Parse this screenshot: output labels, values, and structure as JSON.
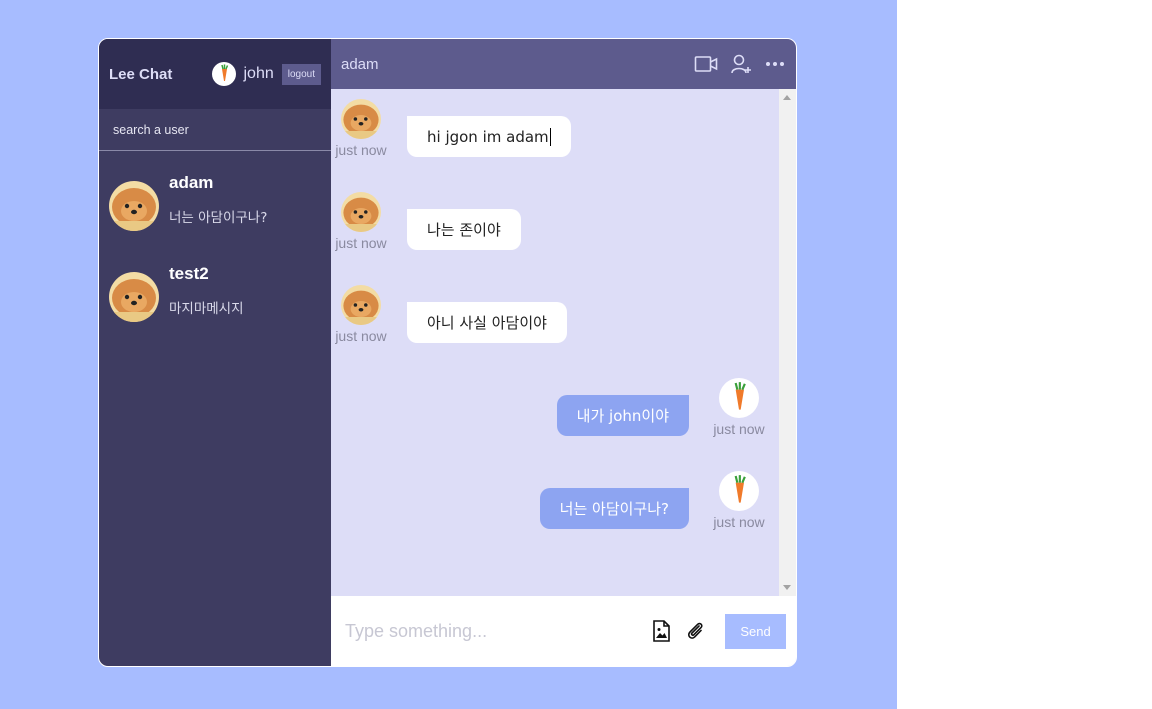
{
  "app": {
    "brand": "Lee Chat"
  },
  "current_user": {
    "name": "john",
    "logout_label": "logout"
  },
  "search": {
    "placeholder": "search a user"
  },
  "chats": [
    {
      "name": "adam",
      "last_message": "너는 아담이구나?"
    },
    {
      "name": "test2",
      "last_message": "마지마메시지"
    }
  ],
  "chat_header": {
    "name": "adam",
    "icons": [
      "video-camera-icon",
      "add-user-icon",
      "more-icon"
    ]
  },
  "messages": [
    {
      "owner": "adam",
      "text": "hi jgon im adam",
      "time": "just now"
    },
    {
      "owner": "adam",
      "text": "나는 존이야",
      "time": "just now"
    },
    {
      "owner": "adam",
      "text": "아니 사실 아담이야",
      "time": "just now"
    },
    {
      "owner": "john",
      "text": "내가 john이야",
      "time": "just now"
    },
    {
      "owner": "john",
      "text": "너는 아담이구나?",
      "time": "just now"
    }
  ],
  "input": {
    "placeholder": "Type something...",
    "send_label": "Send"
  },
  "colors": {
    "page_bg": "#a7bcff",
    "sidebar": "#3e3c61",
    "navbar": "#2f2d52",
    "chat_header": "#5d5b8d",
    "messages_bg": "#ddddf7",
    "own_bubble": "#8da4f1",
    "send_button": "#a7bcff"
  }
}
